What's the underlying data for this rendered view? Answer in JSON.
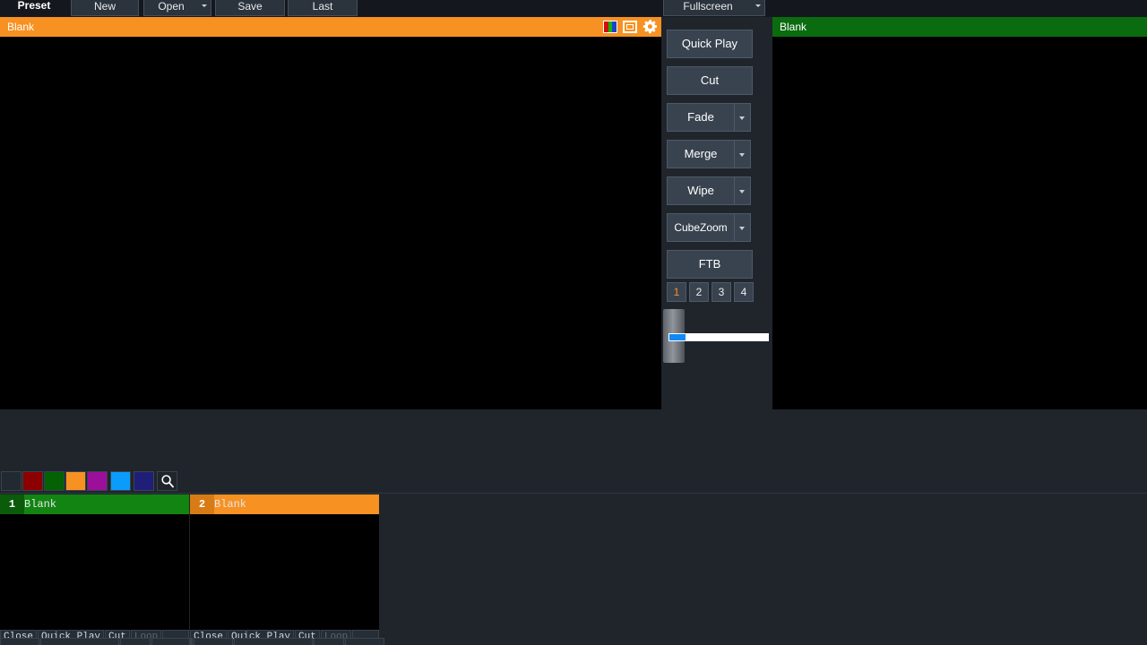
{
  "menu": {
    "preset_label": "Preset",
    "buttons": [
      {
        "label": "New"
      },
      {
        "label": "Open",
        "has_arrow": true
      },
      {
        "label": "Save"
      },
      {
        "label": "Last"
      },
      {
        "label": "Fullscreen",
        "has_arrow": true
      }
    ]
  },
  "program_preview": {
    "title": "Blank",
    "icons": [
      "color-bars-icon",
      "window-icon",
      "gear-icon"
    ]
  },
  "preview_output": {
    "title": "Blank"
  },
  "transitions": {
    "buttons": [
      {
        "label": "Quick Play",
        "arrow": false
      },
      {
        "label": "Cut",
        "arrow": false
      },
      {
        "label": "Fade",
        "arrow": true
      },
      {
        "label": "Merge",
        "arrow": true
      },
      {
        "label": "Wipe",
        "arrow": true
      },
      {
        "label": "CubeZoom",
        "arrow": true
      },
      {
        "label": "FTB",
        "arrow": false
      }
    ],
    "layer_buttons": [
      "1",
      "2",
      "3",
      "4"
    ],
    "selected_layer": "1",
    "tbar_value_percent": 16
  },
  "swatch_bar": {
    "swatches": [
      {
        "name": "swatch-default",
        "color": "#222930"
      },
      {
        "name": "swatch-dark-red",
        "color": "#8c0000"
      },
      {
        "name": "swatch-dark-green",
        "color": "#046104"
      },
      {
        "name": "swatch-orange",
        "color": "#f79122"
      },
      {
        "name": "swatch-magenta",
        "color": "#9b0f9b"
      },
      {
        "name": "swatch-blue",
        "color": "#0b9cfb"
      },
      {
        "name": "swatch-navy",
        "color": "#1f1f7a"
      }
    ],
    "search_icon": "search-icon"
  },
  "cards": [
    {
      "number": "1",
      "title": "Blank",
      "header_style": "green",
      "buttons": [
        {
          "label": "Close",
          "disabled": false
        },
        {
          "label": "Quick Play",
          "disabled": false
        },
        {
          "label": "Cut",
          "disabled": false
        },
        {
          "label": "Loop",
          "disabled": true
        }
      ]
    },
    {
      "number": "2",
      "title": "Blank",
      "header_style": "orange",
      "buttons": [
        {
          "label": "Close",
          "disabled": false
        },
        {
          "label": "Quick Play",
          "disabled": false
        },
        {
          "label": "Cut",
          "disabled": false
        },
        {
          "label": "Loop",
          "disabled": true
        }
      ]
    }
  ],
  "colors": {
    "accent_orange": "#f79122",
    "accent_green": "#0a6b0f",
    "panel_bg": "#1f252b",
    "button_bg": "#39434f",
    "slider_blue": "#1089f5"
  }
}
